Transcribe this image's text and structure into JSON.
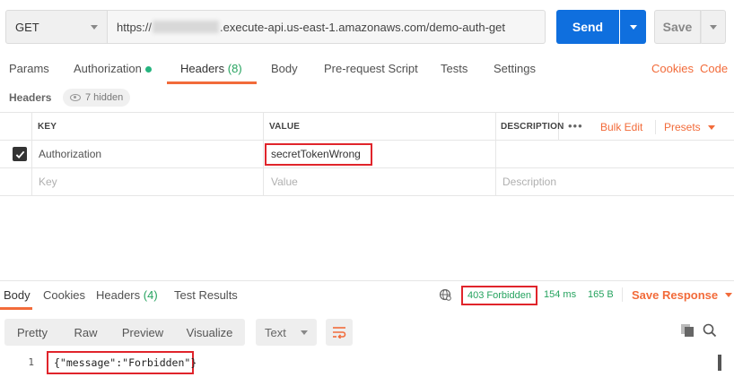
{
  "request": {
    "method": "GET",
    "url_prefix": "https://",
    "url_suffix": ".execute-api.us-east-1.amazonaws.com/demo-auth-get",
    "send_label": "Send",
    "save_label": "Save"
  },
  "tabs": {
    "params": "Params",
    "authorization": "Authorization",
    "headers": "Headers",
    "headers_count": "(8)",
    "body": "Body",
    "prerequest": "Pre-request Script",
    "tests": "Tests",
    "settings": "Settings",
    "cookies": "Cookies",
    "code": "Code"
  },
  "headers_section": {
    "title": "Headers",
    "hidden": "7 hidden"
  },
  "table": {
    "columns": {
      "key": "KEY",
      "value": "VALUE",
      "description": "DESCRIPTION"
    },
    "more": "•••",
    "bulk_edit": "Bulk Edit",
    "presets": "Presets",
    "rows": [
      {
        "checked": true,
        "key": "Authorization",
        "value": "secretTokenWrong",
        "description": ""
      }
    ],
    "placeholder": {
      "key": "Key",
      "value": "Value",
      "description": "Description"
    }
  },
  "response": {
    "tabs": {
      "body": "Body",
      "cookies": "Cookies",
      "headers": "Headers",
      "headers_count": "(4)",
      "tests": "Test Results"
    },
    "status": "403 Forbidden",
    "time": "154 ms",
    "size": "165 B",
    "save_response": "Save Response",
    "views": [
      "Pretty",
      "Raw",
      "Preview",
      "Visualize"
    ],
    "format": "Text",
    "line_number": "1",
    "body_text": "{\"message\":\"Forbidden\"}"
  },
  "colors": {
    "accent": "#f26b3a",
    "send": "#0f6fde",
    "status_ok_green": "#26a35f",
    "highlight_red": "#e0242b"
  }
}
